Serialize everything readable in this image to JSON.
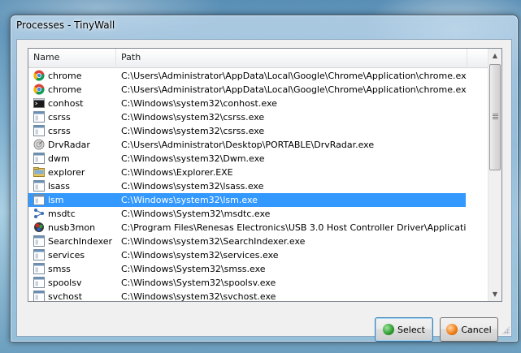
{
  "window": {
    "title": "Processes - TinyWall"
  },
  "list": {
    "columns": {
      "name": "Name",
      "path": "Path"
    },
    "selected_index": 9,
    "rows": [
      {
        "name": "chrome",
        "path": "C:\\Users\\Administrator\\AppData\\Local\\Google\\Chrome\\Application\\chrome.exe",
        "icon": "chrome-icon"
      },
      {
        "name": "chrome",
        "path": "C:\\Users\\Administrator\\AppData\\Local\\Google\\Chrome\\Application\\chrome.exe",
        "icon": "chrome-icon"
      },
      {
        "name": "conhost",
        "path": "C:\\Windows\\system32\\conhost.exe",
        "icon": "console-icon"
      },
      {
        "name": "csrss",
        "path": "C:\\Windows\\system32\\csrss.exe",
        "icon": "generic-exe-icon"
      },
      {
        "name": "csrss",
        "path": "C:\\Windows\\system32\\csrss.exe",
        "icon": "generic-exe-icon"
      },
      {
        "name": "DrvRadar",
        "path": "C:\\Users\\Administrator\\Desktop\\PORTABLE\\DrvRadar.exe",
        "icon": "radar-icon"
      },
      {
        "name": "dwm",
        "path": "C:\\Windows\\system32\\Dwm.exe",
        "icon": "generic-exe-icon"
      },
      {
        "name": "explorer",
        "path": "C:\\Windows\\Explorer.EXE",
        "icon": "explorer-icon"
      },
      {
        "name": "lsass",
        "path": "C:\\Windows\\system32\\lsass.exe",
        "icon": "generic-exe-icon"
      },
      {
        "name": "lsm",
        "path": "C:\\Windows\\system32\\lsm.exe",
        "icon": "generic-exe-icon"
      },
      {
        "name": "msdtc",
        "path": "C:\\Windows\\System32\\msdtc.exe",
        "icon": "msdtc-icon"
      },
      {
        "name": "nusb3mon",
        "path": "C:\\Program Files\\Renesas Electronics\\USB 3.0 Host Controller Driver\\Application\\nus...",
        "icon": "usb-monitor-icon"
      },
      {
        "name": "SearchIndexer",
        "path": "C:\\Windows\\system32\\SearchIndexer.exe",
        "icon": "generic-exe-icon"
      },
      {
        "name": "services",
        "path": "C:\\Windows\\system32\\services.exe",
        "icon": "generic-exe-icon"
      },
      {
        "name": "smss",
        "path": "C:\\Windows\\System32\\smss.exe",
        "icon": "generic-exe-icon"
      },
      {
        "name": "spoolsv",
        "path": "C:\\Windows\\System32\\spoolsv.exe",
        "icon": "generic-exe-icon"
      },
      {
        "name": "svchost",
        "path": "C:\\Windows\\system32\\svchost.exe",
        "icon": "generic-exe-icon"
      }
    ]
  },
  "buttons": {
    "select_label": "Select",
    "cancel_label": "Cancel"
  },
  "colors": {
    "selection": "#3399ff",
    "select_icon": "#2e9a2e",
    "cancel_icon": "#f07a10"
  }
}
